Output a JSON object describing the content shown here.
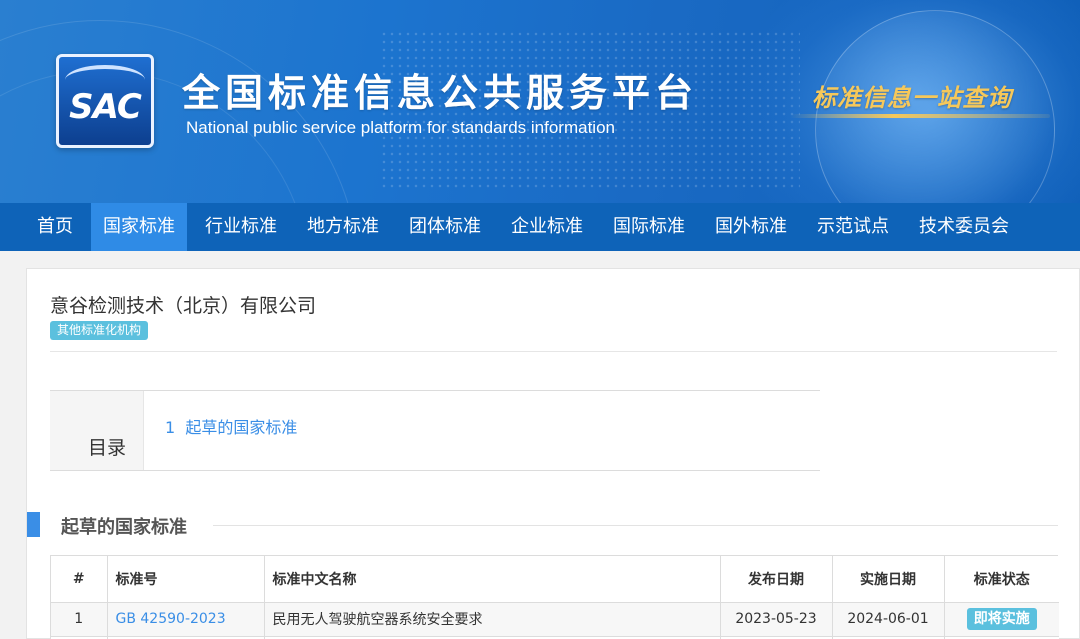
{
  "header": {
    "logo_text": "SAC",
    "title": "全国标准信息公共服务平台",
    "subtitle": "National public service platform  for standards information",
    "slogan": "标准信息一站查询"
  },
  "nav": {
    "items": [
      {
        "label": "首页",
        "active": false
      },
      {
        "label": "国家标准",
        "active": true
      },
      {
        "label": "行业标准",
        "active": false
      },
      {
        "label": "地方标准",
        "active": false
      },
      {
        "label": "团体标准",
        "active": false
      },
      {
        "label": "企业标准",
        "active": false
      },
      {
        "label": "国际标准",
        "active": false
      },
      {
        "label": "国外标准",
        "active": false
      },
      {
        "label": "示范试点",
        "active": false
      },
      {
        "label": "技术委员会",
        "active": false
      }
    ]
  },
  "organization": {
    "name": "意谷检测技术（北京）有限公司",
    "category_badge": "其他标准化机构"
  },
  "toc": {
    "label": "目录",
    "items": [
      {
        "index": "1",
        "label": "起草的国家标准"
      }
    ]
  },
  "section": {
    "title": "起草的国家标准"
  },
  "table": {
    "headers": [
      "#",
      "标准号",
      "标准中文名称",
      "发布日期",
      "实施日期",
      "标准状态"
    ],
    "rows": [
      {
        "num": "1",
        "code": "GB 42590-2023",
        "name": "民用无人驾驶航空器系统安全要求",
        "publish_date": "2023-05-23",
        "implement_date": "2024-06-01",
        "status": "即将实施"
      }
    ]
  },
  "colors": {
    "nav_bg": "#0e63b8",
    "nav_active": "#2f8be6",
    "link": "#3a8ee6",
    "badge": "#5bc0de"
  }
}
